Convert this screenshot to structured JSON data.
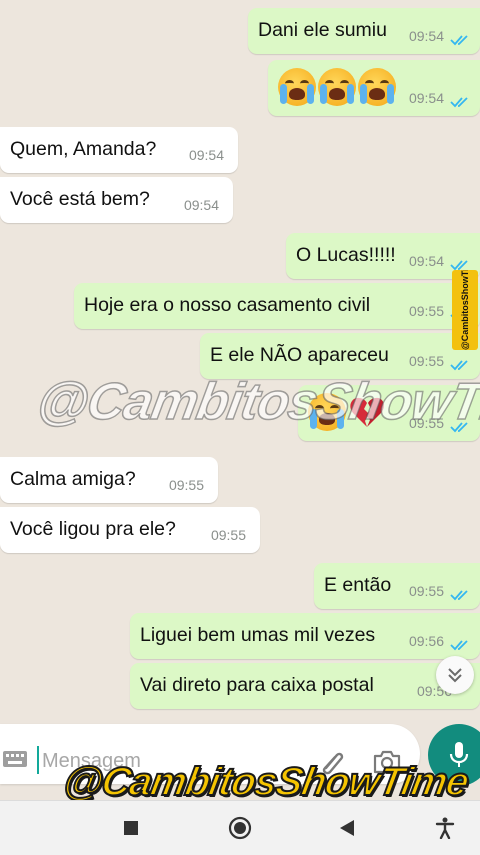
{
  "messages": [
    {
      "dir": "out",
      "text": "Dani ele sumiu",
      "time": "09:54"
    },
    {
      "dir": "out",
      "emoji": [
        "loudly-crying-face",
        "loudly-crying-face",
        "loudly-crying-face"
      ],
      "time": "09:54"
    },
    {
      "dir": "in",
      "text": "Quem, Amanda?",
      "time": "09:54"
    },
    {
      "dir": "in",
      "text": "Você está bem?",
      "time": "09:54"
    },
    {
      "dir": "out",
      "text": "O Lucas!!!!!",
      "time": "09:54"
    },
    {
      "dir": "out",
      "text": "Hoje era o nosso casamento civil",
      "time": "09:55"
    },
    {
      "dir": "out",
      "text": "E ele NÃO apareceu",
      "time": "09:55"
    },
    {
      "dir": "out",
      "emoji": [
        "loudly-crying-face",
        "broken-heart"
      ],
      "time": "09:55"
    },
    {
      "dir": "in",
      "text": "Calma amiga?",
      "time": "09:55"
    },
    {
      "dir": "in",
      "text": "Você ligou pra ele?",
      "time": "09:55"
    },
    {
      "dir": "out",
      "text": "E então",
      "time": "09:55"
    },
    {
      "dir": "out",
      "text": "Liguei bem umas mil vezes",
      "time": "09:56"
    },
    {
      "dir": "out",
      "text": "Vai direto para caixa postal",
      "time": "09:56"
    }
  ],
  "watermark": "@CambitosShowTime",
  "side_watermark": "@CambitosShowTime",
  "banner": "@CambitosShowTime",
  "composer": {
    "placeholder": "Mensagem"
  },
  "icons": {
    "read_receipt": "double-check-icon",
    "keyboard": "keyboard-icon",
    "attach": "paperclip-icon",
    "camera": "camera-icon",
    "mic": "microphone-icon",
    "scroll": "chevron-double-down-icon"
  },
  "colors": {
    "outgoing_bubble": "#dcf8c6",
    "incoming_bubble": "#ffffff",
    "read_tick": "#34b7f1",
    "mic_button": "#128c7e",
    "banner": "#f5c400"
  }
}
